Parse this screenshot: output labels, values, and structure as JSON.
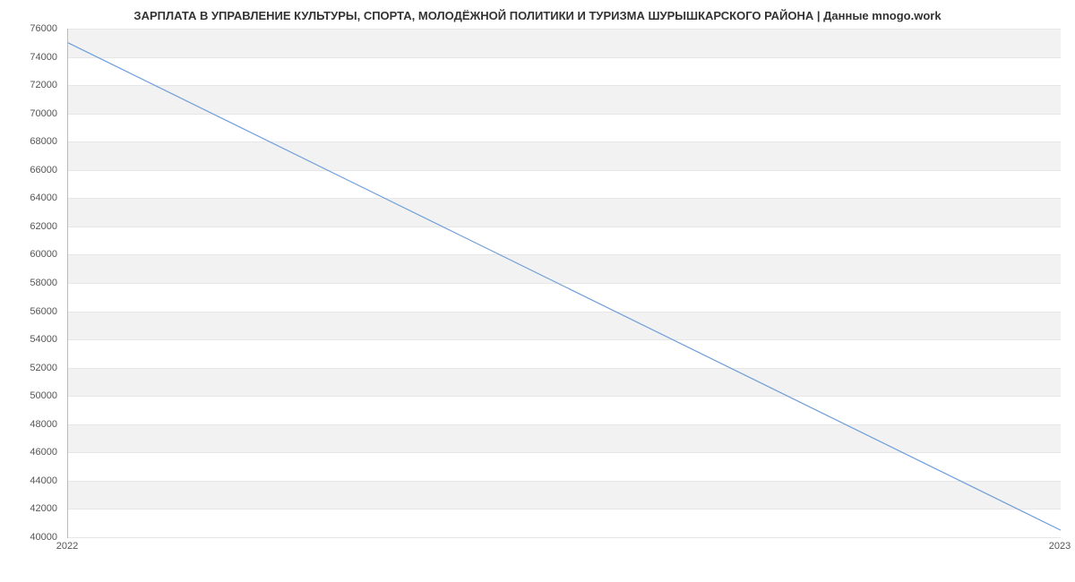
{
  "chart_data": {
    "type": "line",
    "title": "ЗАРПЛАТА В УПРАВЛЕНИЕ  КУЛЬТУРЫ, СПОРТА, МОЛОДЁЖНОЙ ПОЛИТИКИ И ТУРИЗМА  ШУРЫШКАРСКОГО РАЙОНА | Данные mnogo.work",
    "xlabel": "",
    "ylabel": "",
    "x": [
      2022,
      2023
    ],
    "values": [
      75000,
      40500
    ],
    "x_ticks": [
      2022,
      2023
    ],
    "y_ticks": [
      40000,
      42000,
      44000,
      46000,
      48000,
      50000,
      52000,
      54000,
      56000,
      58000,
      60000,
      62000,
      64000,
      66000,
      68000,
      70000,
      72000,
      74000,
      76000
    ],
    "ylim": [
      40000,
      76000
    ],
    "line_color": "#6f9ed8"
  }
}
